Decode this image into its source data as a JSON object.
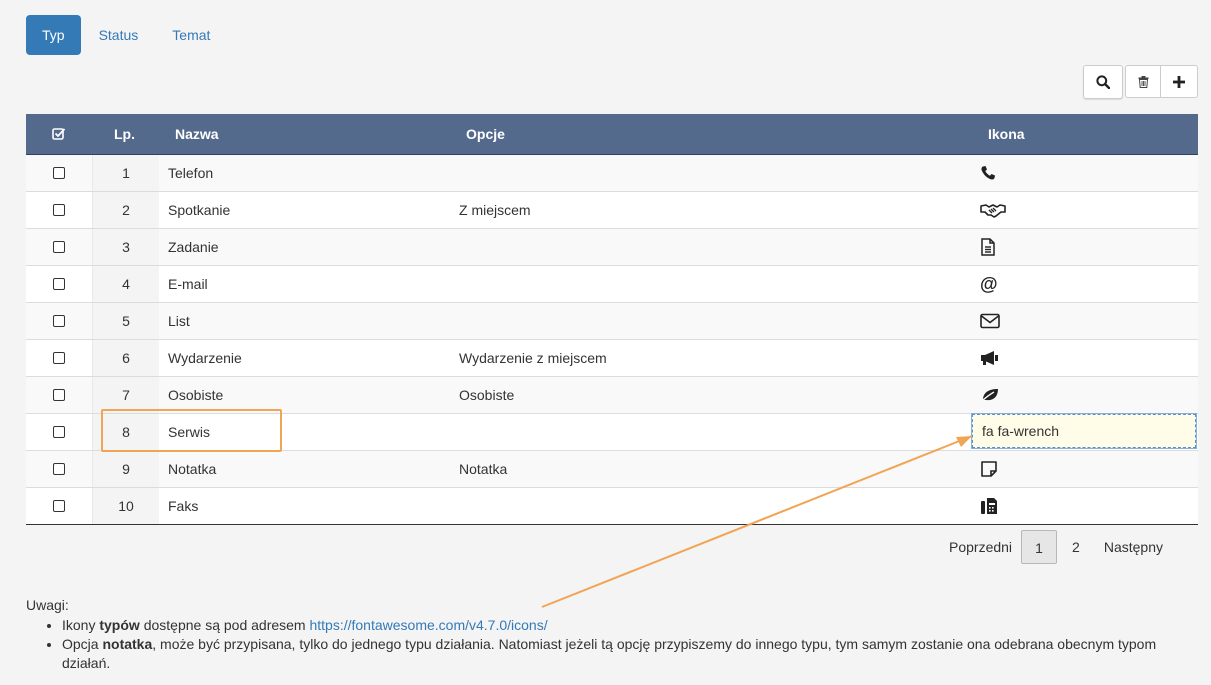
{
  "tabs": [
    {
      "label": "Typ",
      "active": true
    },
    {
      "label": "Status",
      "active": false
    },
    {
      "label": "Temat",
      "active": false
    }
  ],
  "toolbar": {
    "search_icon": "search-icon",
    "delete_icon": "trash-icon",
    "add_icon": "plus-icon"
  },
  "table": {
    "headers": {
      "check": "check-square-icon",
      "lp": "Lp.",
      "name": "Nazwa",
      "options": "Opcje",
      "icon": "Ikona"
    },
    "rows": [
      {
        "lp": "1",
        "name": "Telefon",
        "options": "",
        "icon": "phone"
      },
      {
        "lp": "2",
        "name": "Spotkanie",
        "options": "Z miejscem",
        "icon": "handshake"
      },
      {
        "lp": "3",
        "name": "Zadanie",
        "options": "",
        "icon": "file-text"
      },
      {
        "lp": "4",
        "name": "E-mail",
        "options": "",
        "icon": "at"
      },
      {
        "lp": "5",
        "name": "List",
        "options": "",
        "icon": "envelope"
      },
      {
        "lp": "6",
        "name": "Wydarzenie",
        "options": "Wydarzenie z miejscem",
        "icon": "bullhorn"
      },
      {
        "lp": "7",
        "name": "Osobiste",
        "options": "Osobiste",
        "icon": "leaf"
      },
      {
        "lp": "8",
        "name": "Serwis",
        "options": "",
        "icon": "fa fa-wrench",
        "editing": true
      },
      {
        "lp": "9",
        "name": "Notatka",
        "options": "Notatka",
        "icon": "sticky-note"
      },
      {
        "lp": "10",
        "name": "Faks",
        "options": "",
        "icon": "fax"
      }
    ]
  },
  "pagination": {
    "prev": "Poprzedni",
    "pages": [
      "1",
      "2"
    ],
    "current": "1",
    "next": "Następny"
  },
  "notes": {
    "title": "Uwagi:",
    "item1_pre": "Ikony ",
    "item1_bold": "typów",
    "item1_mid": " dostępne są pod adresem ",
    "item1_link": "https://fontawesome.com/v4.7.0/icons/",
    "item2_pre": "Opcja ",
    "item2_bold": "notatka",
    "item2_rest": ", może być przypisana, tylko do jednego typu działania. Natomiast jeżeli tą opcję przypiszemy do innego typu, tym samym zostanie ona odebrana obecnym typom działań."
  },
  "colors": {
    "accent": "#337ab7",
    "header_bg": "#546a8d",
    "annotation": "#f0a555"
  }
}
